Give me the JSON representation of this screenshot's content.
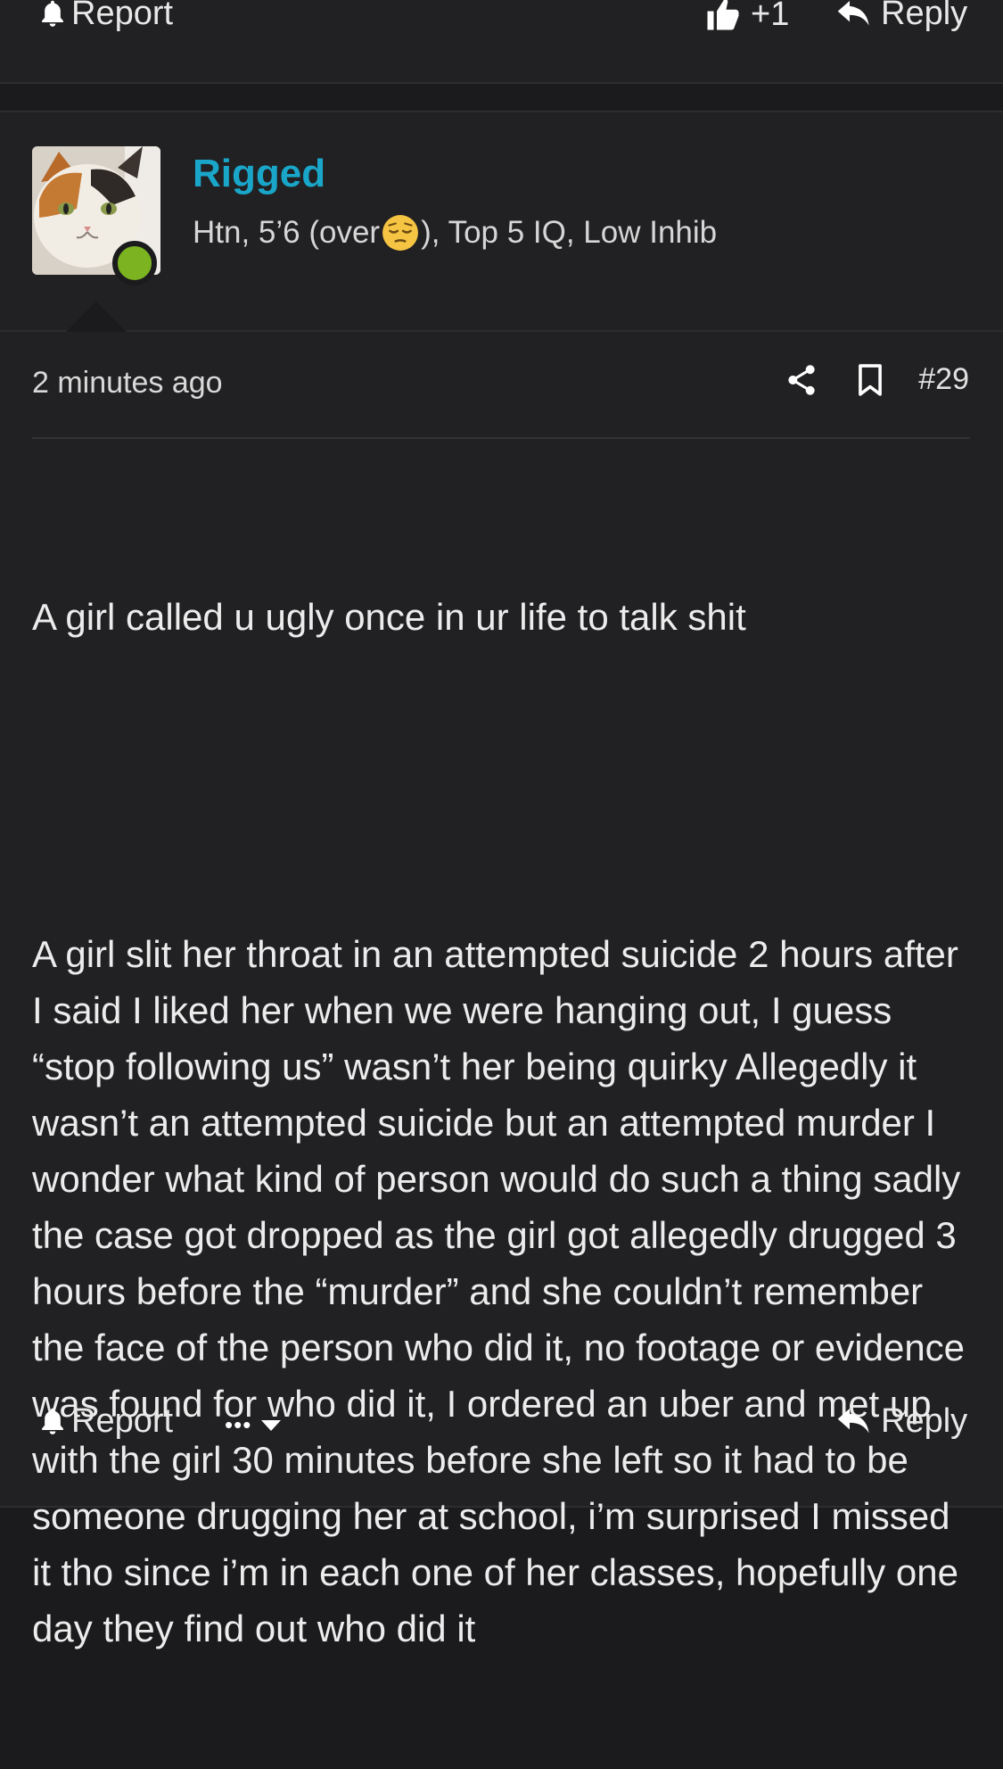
{
  "previous_post_footer": {
    "report_label": "Report",
    "like_count": "+1",
    "reply_label": "Reply"
  },
  "post": {
    "author": {
      "username": "Rigged",
      "title_before_emoji": "Htn, 5’6 (over ",
      "title_emoji": "pensive-face-emoji",
      "title_after_emoji": "), Top 5 IQ, Low Inhib",
      "online": true
    },
    "time_ago": "2 minutes ago",
    "post_number": "#29",
    "paragraphs": [
      "A girl called u ugly once in ur life to talk shit",
      "A girl slit her throat in an attempted suicide 2 hours after I said I liked her when we were hanging out, I guess “stop following us” wasn’t her being quirky Allegedly it wasn’t an attempted suicide but an attempted murder I wonder what kind of person would do such a thing sadly the case got dropped as the girl got allegedly drugged 3 hours before the “murder” and she couldn’t remember the face of the person who did it, no footage or evidence was found for who did it, I ordered an uber and met up with the girl 30 minutes before she left so it had to be someone drugging her at school, i’m surprised I missed it tho since i’m in each one of her classes, hopefully one day they find out who did it"
    ],
    "footer": {
      "report_label": "Report",
      "more_label": "•••",
      "reply_label": "Reply"
    }
  },
  "colors": {
    "background": "#1b1b1d",
    "panel": "#212123",
    "username": "#19a6c9",
    "online": "#7cb320"
  }
}
